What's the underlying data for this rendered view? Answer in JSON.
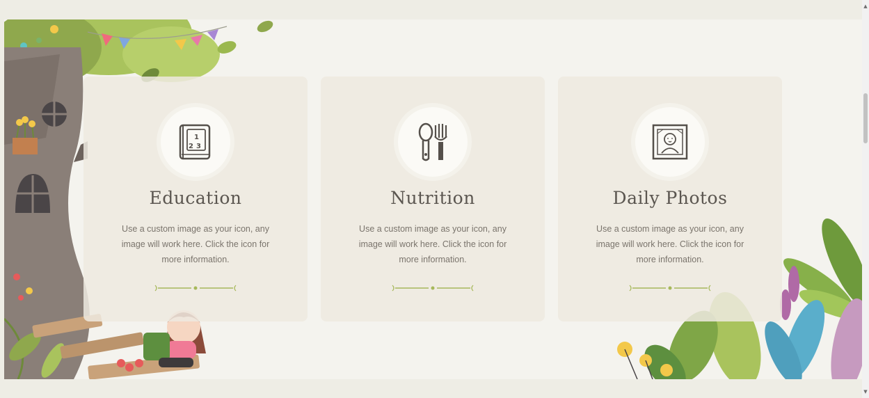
{
  "cards": [
    {
      "title": "Education",
      "description": "Use a custom image as your icon, any image will work here. Click the icon for more information.",
      "icon": "number-book-icon"
    },
    {
      "title": "Nutrition",
      "description": "Use a custom image as your icon, any image will work here. Click the icon for more information.",
      "icon": "spoon-fork-icon"
    },
    {
      "title": "Daily Photos",
      "description": "Use a custom image as your icon, any image will work here. Click the icon for more information.",
      "icon": "baby-photo-frame-icon"
    }
  ],
  "book_glyphs": [
    "1",
    "2",
    "3"
  ],
  "scrollbar": {
    "up_arrow": "▲",
    "down_arrow": "▼"
  },
  "colors": {
    "page_background": "#eeede5",
    "section_background": "#f4f3ee",
    "card_background": "#eee9e0",
    "title_text": "#5b5650",
    "body_text": "#7a746c",
    "divider_green": "#a6b85a"
  }
}
